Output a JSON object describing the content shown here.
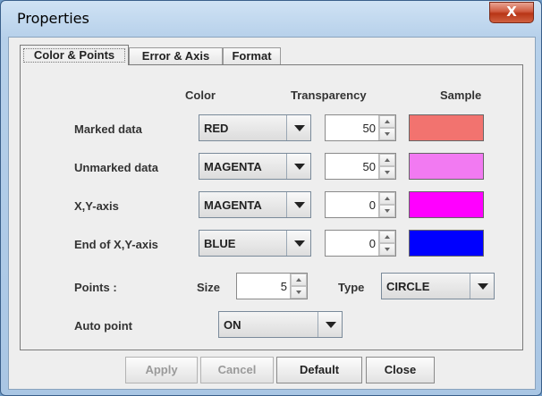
{
  "window": {
    "title": "Properties",
    "close_label": "X"
  },
  "tabs": [
    {
      "label": "Color & Points",
      "active": true
    },
    {
      "label": "Error & Axis",
      "active": false
    },
    {
      "label": "Format",
      "active": false
    }
  ],
  "headers": {
    "color": "Color",
    "transparency": "Transparency",
    "sample": "Sample"
  },
  "rows": [
    {
      "label": "Marked data",
      "color": "RED",
      "transparency": "50",
      "sample_color": "#f2736f"
    },
    {
      "label": "Unmarked data",
      "color": "MAGENTA",
      "transparency": "50",
      "sample_color": "#f27af2"
    },
    {
      "label": "X,Y-axis",
      "color": "MAGENTA",
      "transparency": "0",
      "sample_color": "#ff00ff"
    },
    {
      "label": "End of X,Y-axis",
      "color": "BLUE",
      "transparency": "0",
      "sample_color": "#0000ff"
    }
  ],
  "points": {
    "label": "Points :",
    "size_label": "Size",
    "size_value": "5",
    "type_label": "Type",
    "type_value": "CIRCLE"
  },
  "auto_point": {
    "label": "Auto point",
    "value": "ON"
  },
  "buttons": {
    "apply": "Apply",
    "cancel": "Cancel",
    "default": "Default",
    "close": "Close"
  }
}
